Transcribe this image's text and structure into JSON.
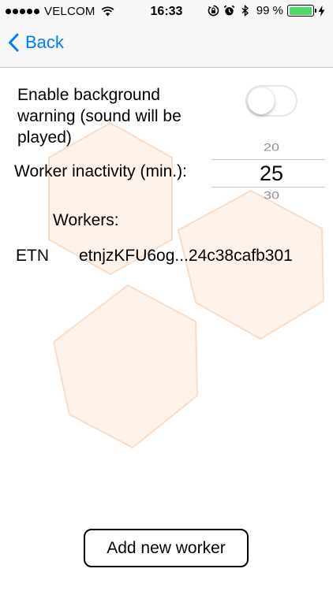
{
  "status_bar": {
    "carrier": "VELCOM",
    "time": "16:33",
    "battery_percent": "99 %",
    "battery_level": 0.99,
    "battery_color": "#4cd964",
    "icons": [
      "signal-dots-icon",
      "wifi-icon",
      "rotation-lock-icon",
      "alarm-icon",
      "bluetooth-icon",
      "battery-icon",
      "charging-bolt-icon"
    ]
  },
  "nav": {
    "back_label": "Back",
    "accent_color": "#007aff"
  },
  "settings": {
    "background_warning_label": "Enable background warning (sound will be played)",
    "background_warning_enabled": false,
    "inactivity_label": "Worker inactivity (min.):",
    "picker": {
      "previous": "20",
      "selected": "25",
      "next": "30"
    }
  },
  "workers": {
    "title": "Workers:",
    "items": [
      {
        "coin": "ETN",
        "address": "etnjzKFU6og...24c38cafb301"
      }
    ]
  },
  "add_button_label": "Add new worker"
}
